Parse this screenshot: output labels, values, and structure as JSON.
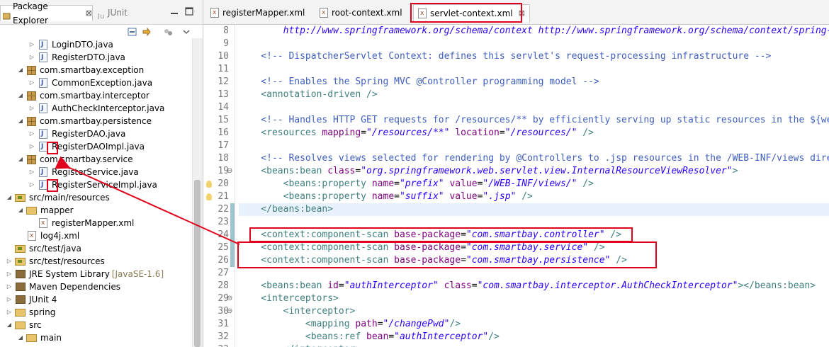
{
  "package_explorer": {
    "tab_label": "Package Explorer",
    "tab_close": "⊠",
    "junit_tab_label": "JUnit",
    "minimize_icon": "minimize-icon",
    "maximize_icon": "maximize-icon",
    "tree": [
      {
        "label": "LoginDTO.java",
        "type": "file",
        "depth": 3,
        "twisty": "▷"
      },
      {
        "label": "RegisterDTO.java",
        "type": "file",
        "depth": 3,
        "twisty": "▷"
      },
      {
        "label": "com.smartbay.exception",
        "type": "pkg",
        "depth": 2,
        "twisty": "◢"
      },
      {
        "label": "CommonException.java",
        "type": "file",
        "depth": 3,
        "twisty": "▷"
      },
      {
        "label": "com.smartbay.interceptor",
        "type": "pkg",
        "depth": 2,
        "twisty": "◢"
      },
      {
        "label": "AuthCheckInterceptor.java",
        "type": "file",
        "depth": 3,
        "twisty": "▷"
      },
      {
        "label": "com.smartbay.persistence",
        "type": "pkg",
        "depth": 2,
        "twisty": "◢"
      },
      {
        "label": "RegisterDAO.java",
        "type": "file",
        "depth": 3,
        "twisty": "▷"
      },
      {
        "label": "RegisterDAOImpl.java",
        "type": "file",
        "depth": 3,
        "twisty": "▷"
      },
      {
        "label": "com.smartbay.service",
        "type": "pkg",
        "depth": 2,
        "twisty": "◢"
      },
      {
        "label": "RegisterService.java",
        "type": "file",
        "depth": 3,
        "twisty": "▷"
      },
      {
        "label": "RegisterServiceImpl.java",
        "type": "file",
        "depth": 3,
        "twisty": "▷"
      },
      {
        "label": "src/main/resources",
        "type": "srcfolder",
        "depth": 1,
        "twisty": "◢"
      },
      {
        "label": "mapper",
        "type": "folder",
        "depth": 2,
        "twisty": "◢"
      },
      {
        "label": "registerMapper.xml",
        "type": "xml",
        "depth": 3,
        "twisty": ""
      },
      {
        "label": "log4j.xml",
        "type": "xml",
        "depth": 2,
        "twisty": ""
      },
      {
        "label": "src/test/java",
        "type": "srcfolder",
        "depth": 1,
        "twisty": ""
      },
      {
        "label": "src/test/resources",
        "type": "srcfolder",
        "depth": 1,
        "twisty": "▷"
      },
      {
        "label": "JRE System Library",
        "suffix": "[JavaSE-1.6]",
        "type": "lib",
        "depth": 1,
        "twisty": "▷"
      },
      {
        "label": "Maven Dependencies",
        "type": "lib",
        "depth": 1,
        "twisty": "▷"
      },
      {
        "label": "JUnit 4",
        "type": "lib",
        "depth": 1,
        "twisty": "▷"
      },
      {
        "label": "spring",
        "type": "folder",
        "depth": 1,
        "twisty": "▷"
      },
      {
        "label": "src",
        "type": "folder",
        "depth": 1,
        "twisty": "◢"
      },
      {
        "label": "main",
        "type": "folder",
        "depth": 2,
        "twisty": "◢"
      }
    ]
  },
  "editor": {
    "tabs": [
      {
        "label": "registerMapper.xml",
        "active": false
      },
      {
        "label": "root-context.xml",
        "active": false
      },
      {
        "label": "servlet-context.xml",
        "active": true,
        "close": "⊠"
      }
    ],
    "lines": [
      {
        "num": "8",
        "segments": [
          {
            "t": "        ",
            "c": "c-text"
          },
          {
            "t": "http://www.springframework.org/schema/context http://www.springframework.org/schema/context/spring-context.xsd",
            "c": "c-url"
          }
        ]
      },
      {
        "num": "9",
        "segments": []
      },
      {
        "num": "10",
        "segments": [
          {
            "t": "    <!-- DispatcherServlet Context: defines this servlet's request-processing infrastructure -->",
            "c": "c-comment"
          }
        ]
      },
      {
        "num": "11",
        "segments": []
      },
      {
        "num": "12",
        "segments": [
          {
            "t": "    <!-- Enables the Spring MVC @Controller programming model -->",
            "c": "c-comment"
          }
        ]
      },
      {
        "num": "13",
        "segments": [
          {
            "t": "    <annotation-driven />",
            "c": "c-tag"
          }
        ]
      },
      {
        "num": "14",
        "segments": []
      },
      {
        "num": "15",
        "segments": [
          {
            "t": "    <!-- Handles HTTP GET requests for /resources/** by efficiently serving up static resources in the ${webappRoot}/resources directory -->",
            "c": "c-comment"
          }
        ]
      },
      {
        "num": "16",
        "segments": [
          {
            "t": "    <resources ",
            "c": "c-tag"
          },
          {
            "t": "mapping",
            "c": "c-attr"
          },
          {
            "t": "=",
            "c": "c-punct"
          },
          {
            "t": "\"/resources/**\"",
            "c": "c-val"
          },
          {
            "t": " ",
            "c": "c-text"
          },
          {
            "t": "location",
            "c": "c-attr"
          },
          {
            "t": "=",
            "c": "c-punct"
          },
          {
            "t": "\"/resources/\"",
            "c": "c-val"
          },
          {
            "t": " />",
            "c": "c-tag"
          }
        ]
      },
      {
        "num": "17",
        "segments": []
      },
      {
        "num": "18",
        "segments": [
          {
            "t": "    <!-- Resolves views selected for rendering by @Controllers to .jsp resources in the /WEB-INF/views directory -->",
            "c": "c-comment"
          }
        ]
      },
      {
        "num": "19",
        "fold": "⊖",
        "segments": [
          {
            "t": "    <beans:bean ",
            "c": "c-tag"
          },
          {
            "t": "class",
            "c": "c-attr"
          },
          {
            "t": "=",
            "c": "c-punct"
          },
          {
            "t": "\"org.springframework.web.servlet.view.InternalResourceViewResolver\"",
            "c": "c-val"
          },
          {
            "t": ">",
            "c": "c-tag"
          }
        ]
      },
      {
        "num": "20",
        "warn": true,
        "segments": [
          {
            "t": "        <beans:property ",
            "c": "c-tag"
          },
          {
            "t": "name",
            "c": "c-attr"
          },
          {
            "t": "=",
            "c": "c-punct"
          },
          {
            "t": "\"prefix\"",
            "c": "c-val"
          },
          {
            "t": " ",
            "c": "c-text"
          },
          {
            "t": "value",
            "c": "c-attr"
          },
          {
            "t": "=",
            "c": "c-punct"
          },
          {
            "t": "\"/WEB-INF/views/\"",
            "c": "c-val"
          },
          {
            "t": " />",
            "c": "c-tag"
          }
        ]
      },
      {
        "num": "21",
        "warn": true,
        "segments": [
          {
            "t": "        <beans:property ",
            "c": "c-tag"
          },
          {
            "t": "name",
            "c": "c-attr"
          },
          {
            "t": "=",
            "c": "c-punct"
          },
          {
            "t": "\"suffix\"",
            "c": "c-val"
          },
          {
            "t": " ",
            "c": "c-text"
          },
          {
            "t": "value",
            "c": "c-attr"
          },
          {
            "t": "=",
            "c": "c-punct"
          },
          {
            "t": "\".jsp\"",
            "c": "c-val"
          },
          {
            "t": " />",
            "c": "c-tag"
          }
        ]
      },
      {
        "num": "22",
        "current": true,
        "segments": [
          {
            "t": "    </beans:bean>",
            "c": "c-tag"
          }
        ]
      },
      {
        "num": "23",
        "segments": []
      },
      {
        "num": "24",
        "segments": [
          {
            "t": "    <context:component-scan ",
            "c": "c-tag"
          },
          {
            "t": "base-package",
            "c": "c-attr"
          },
          {
            "t": "=",
            "c": "c-punct"
          },
          {
            "t": "\"com.smartbay.controller\"",
            "c": "c-val"
          },
          {
            "t": " />",
            "c": "c-tag"
          }
        ]
      },
      {
        "num": "25",
        "segments": [
          {
            "t": "    <context:component-scan ",
            "c": "c-tag"
          },
          {
            "t": "base-package",
            "c": "c-attr"
          },
          {
            "t": "=",
            "c": "c-punct"
          },
          {
            "t": "\"com.smartbay.service\"",
            "c": "c-val"
          },
          {
            "t": " />",
            "c": "c-tag"
          }
        ]
      },
      {
        "num": "26",
        "segments": [
          {
            "t": "    <context:component-scan ",
            "c": "c-tag"
          },
          {
            "t": "base-package",
            "c": "c-attr"
          },
          {
            "t": "=",
            "c": "c-punct"
          },
          {
            "t": "\"com.smartbay.persistence\"",
            "c": "c-val"
          },
          {
            "t": " />",
            "c": "c-tag"
          }
        ]
      },
      {
        "num": "27",
        "segments": []
      },
      {
        "num": "28",
        "segments": [
          {
            "t": "    <beans:bean ",
            "c": "c-tag"
          },
          {
            "t": "id",
            "c": "c-attr"
          },
          {
            "t": "=",
            "c": "c-punct"
          },
          {
            "t": "\"authInterceptor\"",
            "c": "c-val"
          },
          {
            "t": " ",
            "c": "c-text"
          },
          {
            "t": "class",
            "c": "c-attr"
          },
          {
            "t": "=",
            "c": "c-punct"
          },
          {
            "t": "\"com.smartbay.interceptor.AuthCheckInterceptor\"",
            "c": "c-val"
          },
          {
            "t": "></beans:bean>",
            "c": "c-tag"
          }
        ]
      },
      {
        "num": "29",
        "fold": "⊖",
        "segments": [
          {
            "t": "    <interceptors>",
            "c": "c-tag"
          }
        ]
      },
      {
        "num": "30",
        "fold": "⊖",
        "segments": [
          {
            "t": "        <interceptor>",
            "c": "c-tag"
          }
        ]
      },
      {
        "num": "31",
        "segments": [
          {
            "t": "            <mapping ",
            "c": "c-tag"
          },
          {
            "t": "path",
            "c": "c-attr"
          },
          {
            "t": "=",
            "c": "c-punct"
          },
          {
            "t": "\"/changePwd\"",
            "c": "c-val"
          },
          {
            "t": "/>",
            "c": "c-tag"
          }
        ]
      },
      {
        "num": "32",
        "segments": [
          {
            "t": "            <beans:ref ",
            "c": "c-tag"
          },
          {
            "t": "bean",
            "c": "c-attr"
          },
          {
            "t": "=",
            "c": "c-punct"
          },
          {
            "t": "\"authInterceptor\"",
            "c": "c-val"
          },
          {
            "t": "/>",
            "c": "c-tag"
          }
        ]
      },
      {
        "num": "33",
        "segments": [
          {
            "t": "        </interceptor>",
            "c": "c-tag"
          }
        ]
      }
    ]
  },
  "colors": {
    "annotation_red": "#e0001b",
    "comment": "#3f5fbf",
    "tag": "#3f7f7f",
    "attr": "#7f007f",
    "value": "#2a00ff"
  }
}
